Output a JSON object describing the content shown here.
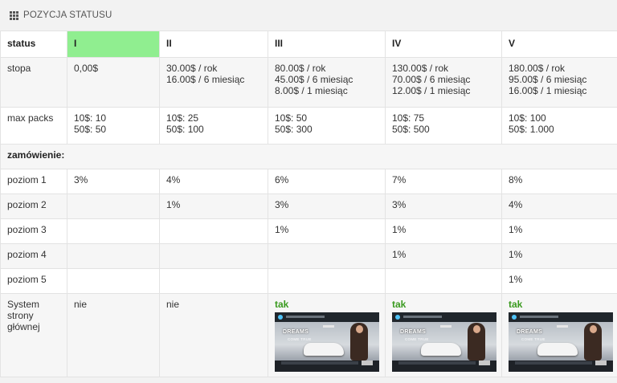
{
  "panel": {
    "title": "POZYCJA STATUSU",
    "icon": "grid-icon"
  },
  "header": {
    "label": "status",
    "levels": [
      "I",
      "II",
      "III",
      "IV",
      "V"
    ],
    "active_color": "#90ee90"
  },
  "rows": {
    "stopa": {
      "label": "stopa",
      "values": [
        [
          "0,00$"
        ],
        [
          "30.00$ / rok",
          "16.00$ / 6 miesiąc"
        ],
        [
          "80.00$ / rok",
          "45.00$ / 6 miesiąc",
          "8.00$ / 1 miesiąc"
        ],
        [
          "130.00$ / rok",
          "70.00$ / 6 miesiąc",
          "12.00$ / 1 miesiąc"
        ],
        [
          "180.00$ / rok",
          "95.00$ / 6 miesiąc",
          "16.00$ / 1 miesiąc"
        ]
      ]
    },
    "max_packs": {
      "label": "max packs",
      "values": [
        [
          "10$: 10",
          "50$: 50"
        ],
        [
          "10$: 25",
          "50$: 100"
        ],
        [
          "10$: 50",
          "50$: 300"
        ],
        [
          "10$: 75",
          "50$: 500"
        ],
        [
          "10$: 100",
          "50$: 1.000"
        ]
      ]
    },
    "section": {
      "label": "zamówienie:"
    },
    "levels": [
      {
        "label": "poziom 1",
        "values": [
          "3%",
          "4%",
          "6%",
          "7%",
          "8%"
        ]
      },
      {
        "label": "poziom 2",
        "values": [
          "",
          "1%",
          "3%",
          "3%",
          "4%"
        ]
      },
      {
        "label": "poziom 3",
        "values": [
          "",
          "",
          "1%",
          "1%",
          "1%"
        ]
      },
      {
        "label": "poziom 4",
        "values": [
          "",
          "",
          "",
          "1%",
          "1%"
        ]
      },
      {
        "label": "poziom 5",
        "values": [
          "",
          "",
          "",
          "",
          "1%"
        ]
      }
    ],
    "system": {
      "label": "System strony głównej",
      "values": [
        "nie",
        "nie",
        "tak",
        "tak",
        "tak"
      ],
      "thumb": {
        "headline": "DREAMS",
        "subline": "COME TRUE"
      }
    }
  },
  "colors": {
    "yes": "#3a9a1f"
  }
}
